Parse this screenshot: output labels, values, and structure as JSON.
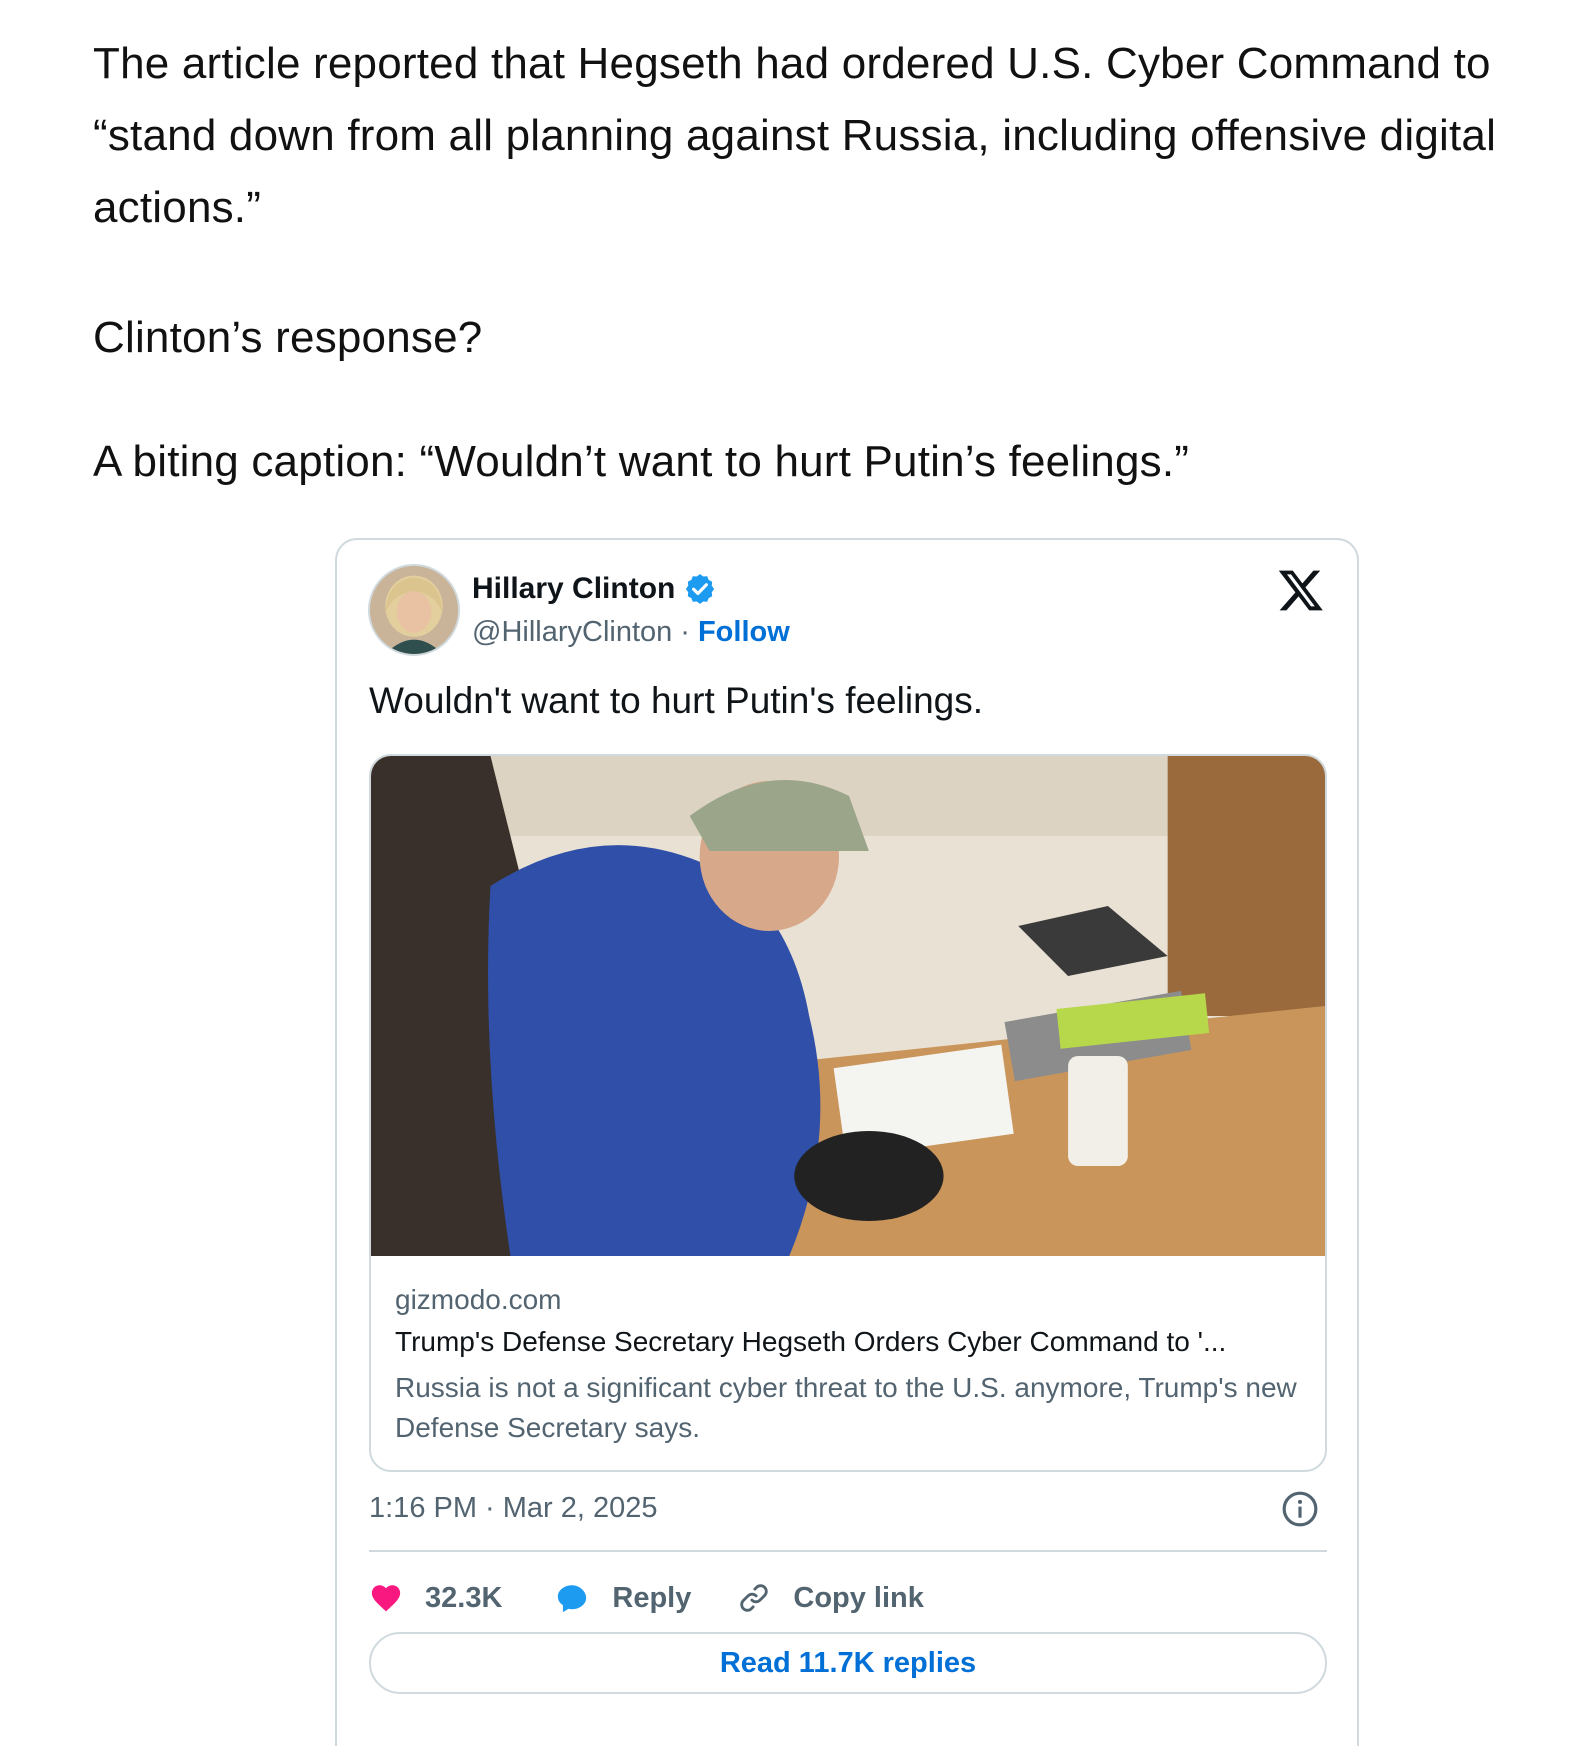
{
  "article": {
    "paragraph_1": "The article reported that Hegseth had ordered U.S. Cyber Command to “stand down from all planning against Russia, including offensive digital actions.”",
    "paragraph_2": "Clinton’s response?",
    "paragraph_3": "A biting caption: “Wouldn’t want to hurt Putin’s feelings.”"
  },
  "tweet": {
    "author_name": "Hillary Clinton",
    "handle": "@HillaryClinton",
    "separator": "·",
    "follow_label": "Follow",
    "text": "Wouldn't want to hurt Putin's feelings.",
    "link_card": {
      "domain": "gizmodo.com",
      "title": "Trump's Defense Secretary Hegseth Orders Cyber Command to '...",
      "description": "Russia is not a significant cyber threat to the U.S. anymore, Trump's new Defense Secretary says."
    },
    "timestamp": "1:16 PM · Mar 2, 2025",
    "actions": {
      "like_count": "32.3K",
      "reply_label": "Reply",
      "copy_link_label": "Copy link"
    },
    "read_replies_label": "Read 11.7K replies"
  },
  "icons": {
    "verified": "verified-badge-icon",
    "platform": "x-logo-icon",
    "info": "info-icon",
    "like": "heart-icon",
    "reply": "speech-bubble-icon",
    "copy_link": "link-icon"
  },
  "colors": {
    "link_blue": "#006fd6",
    "verified_blue": "#1d9bf0",
    "heart_pink": "#f91880",
    "muted_text": "#536471",
    "border": "#cfd9de"
  }
}
